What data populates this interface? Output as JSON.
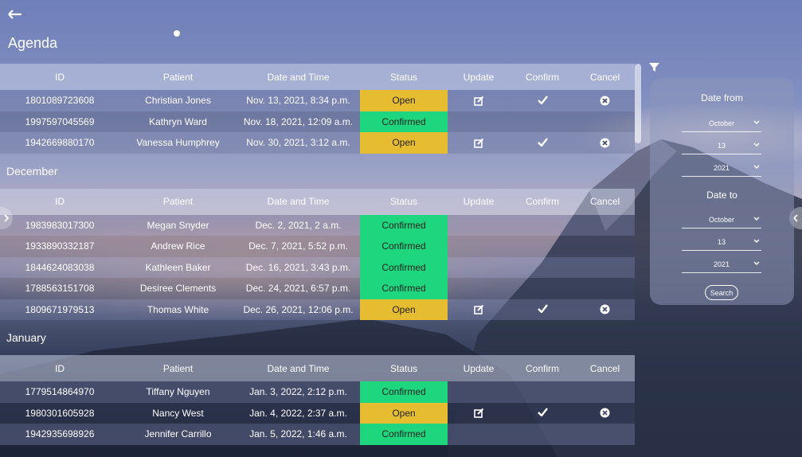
{
  "header": {
    "title": "Agenda",
    "back_icon": "arrow-left-icon"
  },
  "table_headers": {
    "id": "ID",
    "patient": "Patient",
    "datetime": "Date and Time",
    "status": "Status",
    "update": "Update",
    "confirm": "Confirm",
    "cancel": "Cancel"
  },
  "groups": [
    {
      "month": "",
      "rows": [
        {
          "id": "1801089723608",
          "patient": "Christian Jones",
          "datetime": "Nov. 13, 2021, 8:34 p.m.",
          "status": "Open"
        },
        {
          "id": "1997597045569",
          "patient": "Kathryn Ward",
          "datetime": "Nov. 18, 2021, 12:09 a.m.",
          "status": "Confirmed"
        },
        {
          "id": "1942669880170",
          "patient": "Vanessa Humphrey",
          "datetime": "Nov. 30, 2021, 3:12 a.m.",
          "status": "Open"
        }
      ]
    },
    {
      "month": "December",
      "rows": [
        {
          "id": "1983983017300",
          "patient": "Megan Snyder",
          "datetime": "Dec. 2, 2021, 2 a.m.",
          "status": "Confirmed"
        },
        {
          "id": "1933890332187",
          "patient": "Andrew Rice",
          "datetime": "Dec. 7, 2021, 5:52 p.m.",
          "status": "Confirmed"
        },
        {
          "id": "1844624083038",
          "patient": "Kathleen Baker",
          "datetime": "Dec. 16, 2021, 3:43 p.m.",
          "status": "Confirmed"
        },
        {
          "id": "1788563151708",
          "patient": "Desiree Clements",
          "datetime": "Dec. 24, 2021, 6:57 p.m.",
          "status": "Confirmed"
        },
        {
          "id": "1809671979513",
          "patient": "Thomas White",
          "datetime": "Dec. 26, 2021, 12:06 p.m.",
          "status": "Open"
        }
      ]
    },
    {
      "month": "January",
      "rows": [
        {
          "id": "1779514864970",
          "patient": "Tiffany Nguyen",
          "datetime": "Jan. 3, 2022, 2:12 p.m.",
          "status": "Confirmed"
        },
        {
          "id": "1980301605928",
          "patient": "Nancy West",
          "datetime": "Jan. 4, 2022, 2:37 a.m.",
          "status": "Open"
        },
        {
          "id": "1942935698926",
          "patient": "Jennifer Carrillo",
          "datetime": "Jan. 5, 2022, 1:46 a.m.",
          "status": "Confirmed"
        }
      ]
    }
  ],
  "filter": {
    "date_from_label": "Date from",
    "from_month": "October",
    "from_day": "13",
    "from_year": "2021",
    "date_to_label": "Date to",
    "to_month": "October",
    "to_day": "13",
    "to_year": "2021",
    "search_label": "Search"
  },
  "colors": {
    "open": "#e6bd31",
    "confirmed": "#1ed67d"
  },
  "icons": {
    "update": "edit-icon",
    "confirm": "check-icon",
    "cancel": "cancel-circle-icon",
    "filter": "filter-icon"
  }
}
